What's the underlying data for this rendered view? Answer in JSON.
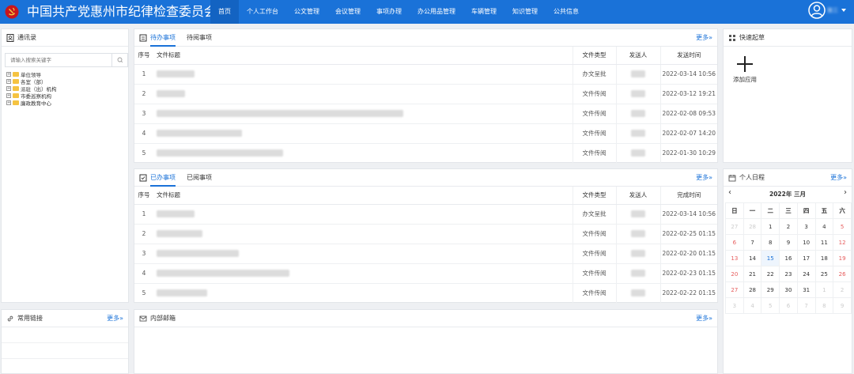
{
  "header": {
    "title": "中国共产党惠州市纪律检查委员会",
    "nav": [
      "首页",
      "个人工作台",
      "公文管理",
      "会议管理",
      "事项办理",
      "办公用品管理",
      "车辆管理",
      "知识管理",
      "公共信息"
    ],
    "active_nav_index": 0,
    "user_name": "张三"
  },
  "address_book": {
    "title": "通讯录",
    "search_placeholder": "请输入搜索关键字",
    "tree": [
      "单位领导",
      "各室（部）",
      "派驻（出）机构",
      "市委巡察机构",
      "廉政教育中心"
    ]
  },
  "pending": {
    "tabs": [
      "待办事项",
      "待阅事项"
    ],
    "more": "更多",
    "columns": {
      "no": "序号",
      "title": "文件标题",
      "type": "文件类型",
      "sender": "发送人",
      "time": "发送时间"
    },
    "rows": [
      {
        "no": "1",
        "type": "办文呈批",
        "time": "2022-03-14 10:56"
      },
      {
        "no": "2",
        "type": "文件传阅",
        "time": "2022-03-12 19:21"
      },
      {
        "no": "3",
        "type": "文件传阅",
        "time": "2022-02-08 09:53"
      },
      {
        "no": "4",
        "type": "文件传阅",
        "time": "2022-02-07 14:20"
      },
      {
        "no": "5",
        "type": "文件传阅",
        "time": "2022-01-30 10:29"
      }
    ]
  },
  "done": {
    "tabs": [
      "已办事项",
      "已阅事项"
    ],
    "more": "更多",
    "columns": {
      "no": "序号",
      "title": "文件标题",
      "type": "文件类型",
      "sender": "发送人",
      "time": "完成时间"
    },
    "rows": [
      {
        "no": "1",
        "type": "办文呈批",
        "time": "2022-03-14 10:56"
      },
      {
        "no": "2",
        "type": "文件传阅",
        "time": "2022-02-25 01:15"
      },
      {
        "no": "3",
        "type": "文件传阅",
        "time": "2022-02-20 01:15"
      },
      {
        "no": "4",
        "type": "文件传阅",
        "time": "2022-02-23 01:15"
      },
      {
        "no": "5",
        "type": "文件传阅",
        "time": "2022-02-22 01:15"
      }
    ]
  },
  "quick_start": {
    "title": "快速起草",
    "add_label": "添加应用"
  },
  "schedule": {
    "title": "个人日程",
    "more": "更多",
    "month_label": "2022年 三月",
    "weekdays": [
      "日",
      "一",
      "二",
      "三",
      "四",
      "五",
      "六"
    ],
    "weeks": [
      [
        "27",
        "28",
        "1",
        "2",
        "3",
        "4",
        "5"
      ],
      [
        "6",
        "7",
        "8",
        "9",
        "10",
        "11",
        "12"
      ],
      [
        "13",
        "14",
        "15",
        "16",
        "17",
        "18",
        "19"
      ],
      [
        "20",
        "21",
        "22",
        "23",
        "24",
        "25",
        "26"
      ],
      [
        "27",
        "28",
        "29",
        "30",
        "31",
        "1",
        "2"
      ],
      [
        "3",
        "4",
        "5",
        "6",
        "7",
        "8",
        "9"
      ]
    ],
    "today": "15"
  },
  "links": {
    "title": "常用链接",
    "more": "更多"
  },
  "mail": {
    "title": "内部邮箱",
    "more": "更多"
  },
  "colors": {
    "primary": "#1a72d8",
    "nav_active": "#1363c2",
    "weekend": "#e65c5c"
  }
}
